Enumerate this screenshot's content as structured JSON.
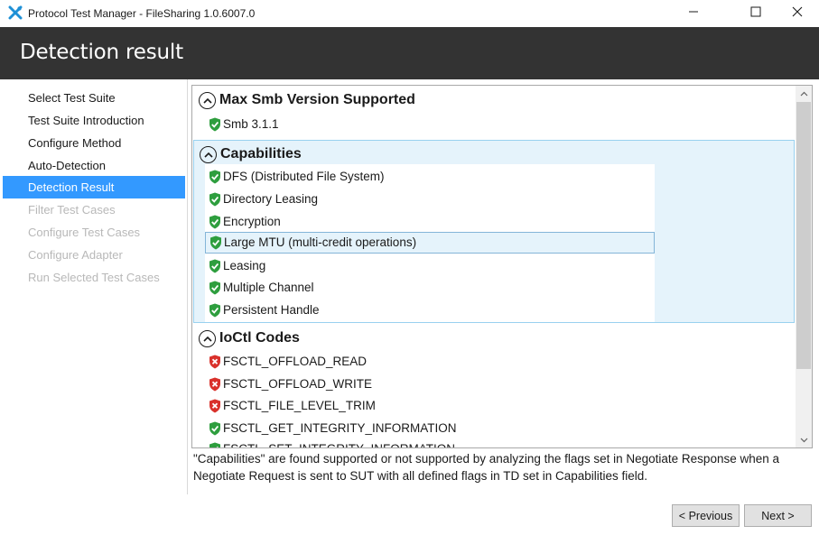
{
  "window": {
    "title": "Protocol Test Manager - FileSharing 1.0.6007.0",
    "icons": {
      "app": "x-tool-icon",
      "minimize": "minimize-icon",
      "maximize": "maximize-icon",
      "close": "close-icon"
    },
    "accent": "#3399ff"
  },
  "header": {
    "title": "Detection result",
    "background": "#333333"
  },
  "nav": {
    "items": [
      {
        "label": "Select Test Suite",
        "state": "normal"
      },
      {
        "label": "Test Suite Introduction",
        "state": "normal"
      },
      {
        "label": "Configure Method",
        "state": "normal"
      },
      {
        "label": "Auto-Detection",
        "state": "normal"
      },
      {
        "label": "Detection Result",
        "state": "active"
      },
      {
        "label": "Filter Test Cases",
        "state": "disabled"
      },
      {
        "label": "Configure Test Cases",
        "state": "disabled"
      },
      {
        "label": "Configure Adapter",
        "state": "disabled"
      },
      {
        "label": "Run Selected Test Cases",
        "state": "disabled"
      }
    ]
  },
  "results": {
    "sections": [
      {
        "title": "Max Smb Version Supported",
        "items": [
          {
            "label": "Smb 3.1.1",
            "status": "supported"
          }
        ]
      },
      {
        "title": "Capabilities",
        "items": [
          {
            "label": "DFS (Distributed File System)",
            "status": "supported"
          },
          {
            "label": "Directory Leasing",
            "status": "supported"
          },
          {
            "label": "Encryption",
            "status": "supported"
          },
          {
            "label": "Large MTU (multi-credit operations)",
            "status": "supported"
          },
          {
            "label": "Leasing",
            "status": "supported"
          },
          {
            "label": "Multiple Channel",
            "status": "supported"
          },
          {
            "label": "Persistent Handle",
            "status": "supported"
          }
        ]
      },
      {
        "title": "IoCtl Codes",
        "items": [
          {
            "label": "FSCTL_OFFLOAD_READ",
            "status": "not-supported"
          },
          {
            "label": "FSCTL_OFFLOAD_WRITE",
            "status": "not-supported"
          },
          {
            "label": "FSCTL_FILE_LEVEL_TRIM",
            "status": "not-supported"
          },
          {
            "label": "FSCTL_GET_INTEGRITY_INFORMATION",
            "status": "supported"
          },
          {
            "label": "FSCTL_SET_INTEGRITY_INFORMATION",
            "status": "supported"
          }
        ]
      }
    ],
    "status_colors": {
      "supported": "#2e9e3e",
      "not-supported": "#d9312b"
    },
    "status_icons": {
      "supported": "green-shield-check-icon",
      "not-supported": "red-shield-x-icon"
    }
  },
  "note": "\"Capabilities\" are found supported or not supported by analyzing the flags set in Negotiate Response when a Negotiate Request is sent to SUT with all defined flags in TD set in Capabilities field.",
  "buttons": {
    "previous": "< Previous",
    "next": "Next >"
  }
}
